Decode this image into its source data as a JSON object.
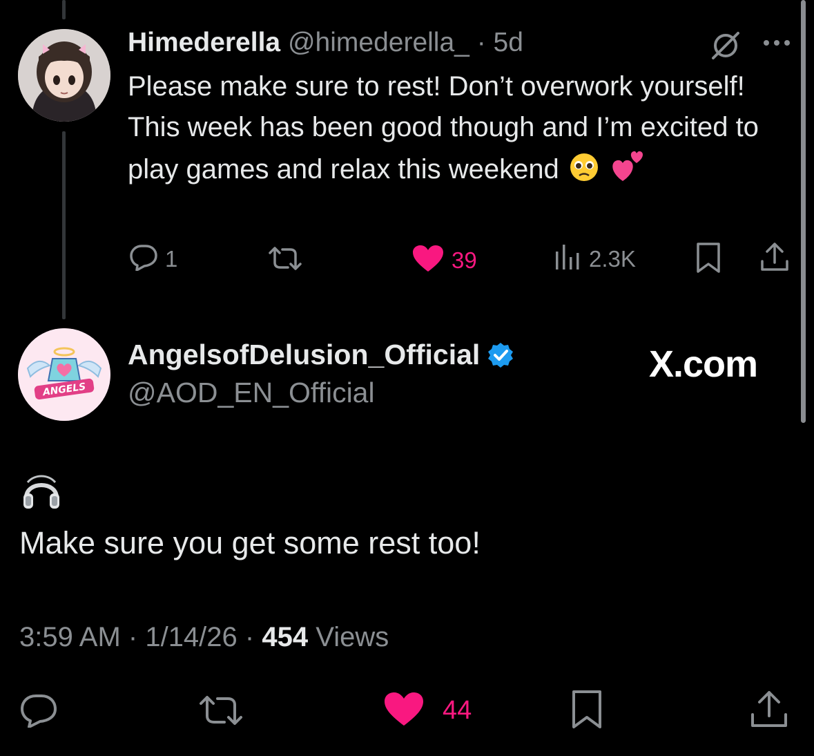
{
  "reply_post": {
    "author_name": "Himederella",
    "author_handle": "@himederella_",
    "time_ago": "5d",
    "text": "Please make sure to rest! Don’t overwork yourself! This week has been good though and I’m excited to play games and relax this weekend",
    "emojis": [
      "pleading-face",
      "two-hearts"
    ],
    "replies": "1",
    "likes": "39",
    "views": "2.3K",
    "liked": true
  },
  "main_post": {
    "author_name": "AngelsofDelusion_Official",
    "author_handle": "@AOD_EN_Official",
    "verified": true,
    "text_line1_icon": "headphones",
    "text": "Make sure you get some rest too!",
    "time": "3:59 AM",
    "date": "1/14/26",
    "views_count": "454",
    "views_label": "Views",
    "likes": "44",
    "liked": true
  },
  "watermark": "X.com",
  "colors": {
    "background": "#000000",
    "text": "#e7e9ea",
    "muted": "#8b8f93",
    "like": "#f91880",
    "verified": "#1d9bf0"
  }
}
